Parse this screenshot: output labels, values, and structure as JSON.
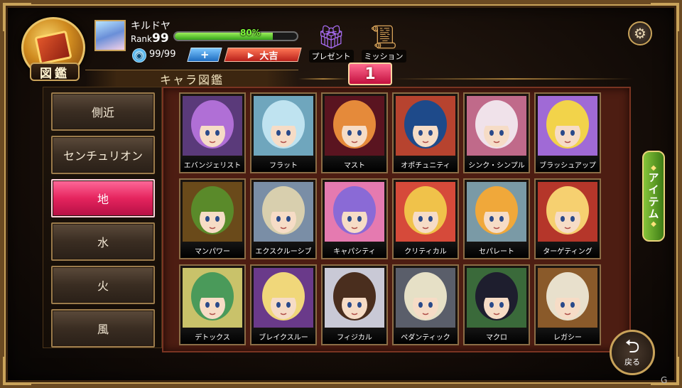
{
  "header": {
    "book_label": "図鑑",
    "player_name": "キルドヤ",
    "rank_prefix": "Rank",
    "rank_value": "99",
    "exp_percent_text": "80%",
    "exp_fraction": 0.8,
    "stamina": "99/99",
    "plus_label": "+",
    "fortune_label": "大吉",
    "fortune_arrow": "▶",
    "present_label": "プレゼント",
    "mission_label": "ミッション",
    "settings_icon": "gear-icon"
  },
  "title": "キャラ図鑑",
  "page_number": "1",
  "categories": [
    {
      "label": "側近",
      "active": false
    },
    {
      "label": "センチュリオン",
      "active": false
    },
    {
      "label": "地",
      "active": true
    },
    {
      "label": "水",
      "active": false
    },
    {
      "label": "火",
      "active": false
    },
    {
      "label": "風",
      "active": false
    }
  ],
  "characters": [
    {
      "name": "エバンジェリスト",
      "hair": "#b06fd6",
      "bg": "#5a3a7a"
    },
    {
      "name": "フラット",
      "hair": "#bfe3f0",
      "bg": "#6fa6bd"
    },
    {
      "name": "マスト",
      "hair": "#e58a3a",
      "bg": "#5a1420"
    },
    {
      "name": "オポチュニティ",
      "hair": "#1e4a8a",
      "bg": "#b7432f"
    },
    {
      "name": "シンク・シンプル",
      "hair": "#f0e2ea",
      "bg": "#c06a8a"
    },
    {
      "name": "ブラッシュアップ",
      "hair": "#f2d34a",
      "bg": "#a06ad6"
    },
    {
      "name": "マンパワー",
      "hair": "#5a8a2a",
      "bg": "#6a4a1a"
    },
    {
      "name": "エクスクルーシブ",
      "hair": "#d8cfae",
      "bg": "#7a8ea6"
    },
    {
      "name": "キャパシティ",
      "hair": "#8a6ad6",
      "bg": "#e57ab0"
    },
    {
      "name": "クリティカル",
      "hair": "#f0c24a",
      "bg": "#d64a3a"
    },
    {
      "name": "セパレート",
      "hair": "#f0a83a",
      "bg": "#7a9aa6"
    },
    {
      "name": "ターゲティング",
      "hair": "#f6d070",
      "bg": "#b5362a"
    },
    {
      "name": "デトックス",
      "hair": "#4a9a5a",
      "bg": "#c9c26a"
    },
    {
      "name": "ブレイクスルー",
      "hair": "#f0d77a",
      "bg": "#6a3a8a"
    },
    {
      "name": "フィジカル",
      "hair": "#4a2e1e",
      "bg": "#c9c9d6"
    },
    {
      "name": "ペダンティック",
      "hair": "#e6e0c6",
      "bg": "#5a5e6a"
    },
    {
      "name": "マクロ",
      "hair": "#1e1e2e",
      "bg": "#3a6a3a"
    },
    {
      "name": "レガシー",
      "hair": "#e8e0cc",
      "bg": "#8a5a2a"
    }
  ],
  "side": {
    "item_label": "アイテム",
    "item_arrow": "◆",
    "back_label": "戻る",
    "back_icon": "return-arrow-icon"
  },
  "watermark": "G"
}
